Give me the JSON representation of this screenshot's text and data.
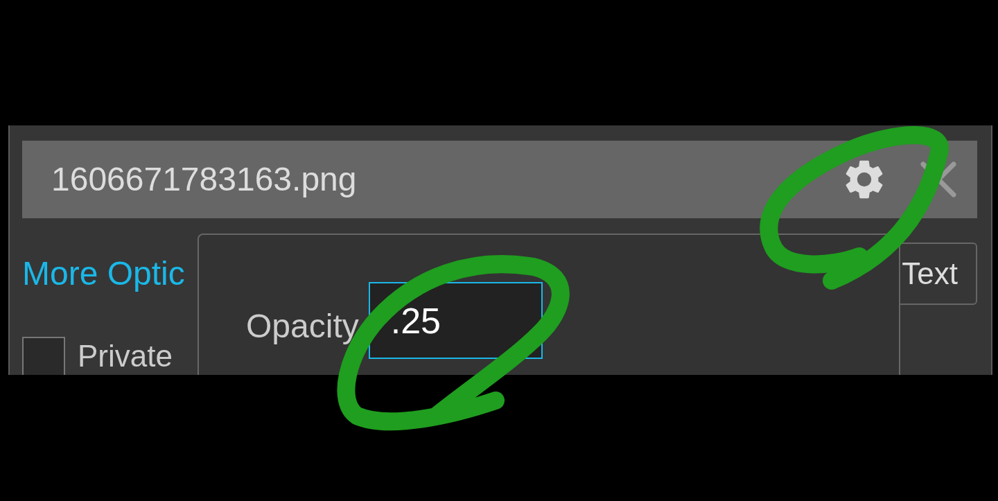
{
  "file_bar": {
    "filename": "1606671783163.png"
  },
  "more_options_link": "More Optic",
  "private_checkbox": {
    "label": "Private",
    "checked": false
  },
  "text_button": "Text",
  "opacity_popup": {
    "label": "Opacity",
    "value": ".25",
    "focused": true
  }
}
